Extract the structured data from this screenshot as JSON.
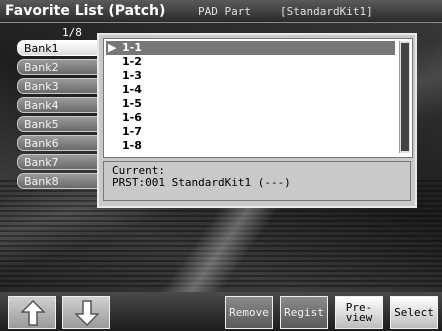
{
  "header": {
    "title": "Favorite List (Patch)",
    "subtitle": "PAD Part",
    "kit": "[StandardKit1]"
  },
  "page_indicator": "1/8",
  "banks": [
    {
      "label": "Bank1",
      "active": true
    },
    {
      "label": "Bank2",
      "active": false
    },
    {
      "label": "Bank3",
      "active": false
    },
    {
      "label": "Bank4",
      "active": false
    },
    {
      "label": "Bank5",
      "active": false
    },
    {
      "label": "Bank6",
      "active": false
    },
    {
      "label": "Bank7",
      "active": false
    },
    {
      "label": "Bank8",
      "active": false
    }
  ],
  "list": {
    "selected_marker": "▶",
    "items": [
      "1-1",
      "1-2",
      "1-3",
      "1-4",
      "1-5",
      "1-6",
      "1-7",
      "1-8"
    ]
  },
  "current": {
    "label": "Current:",
    "value": "PRST:001 StandardKit1 (---)"
  },
  "buttons": {
    "remove": "Remove",
    "regist": "Regist",
    "preview": "Pre-\nview",
    "select": "Select"
  },
  "icons": {
    "up": "arrow-up-icon",
    "down": "arrow-down-icon"
  }
}
